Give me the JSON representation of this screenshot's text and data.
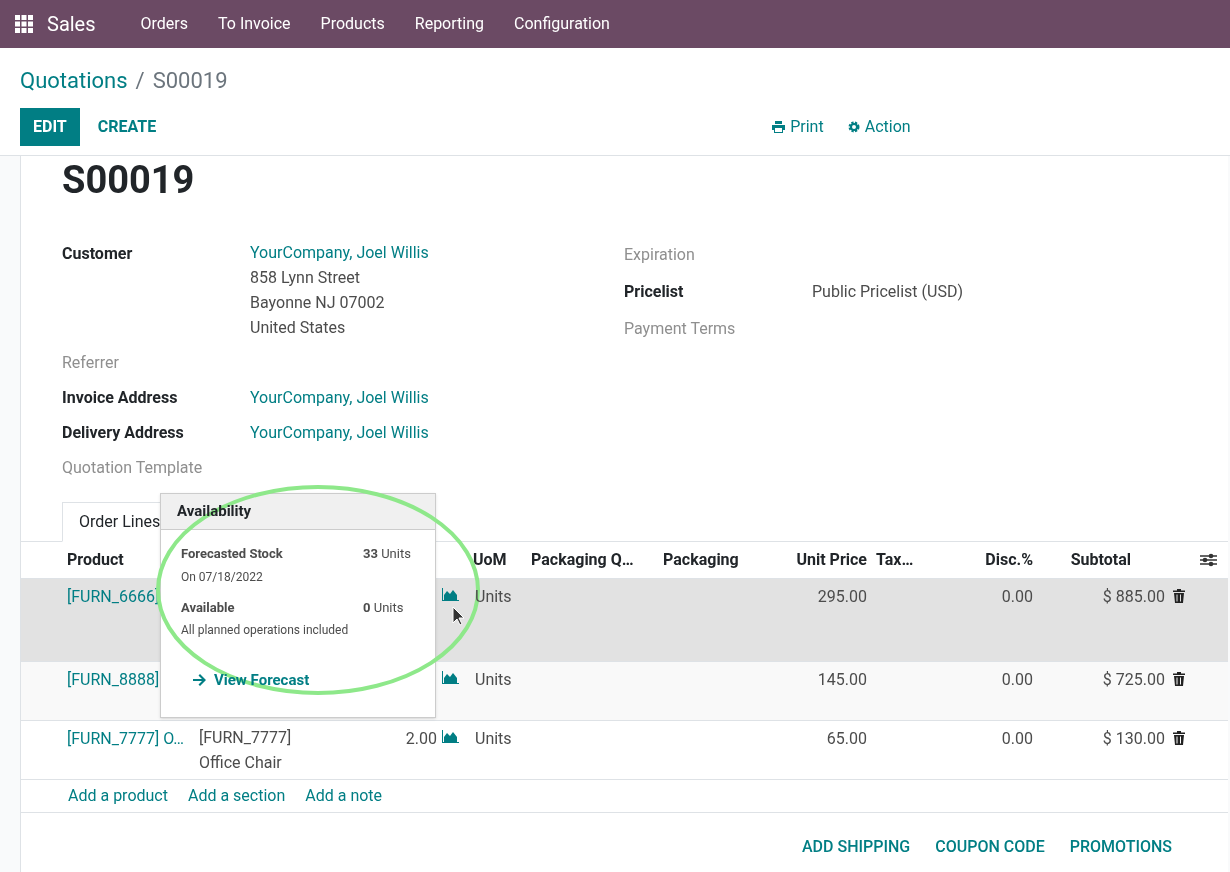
{
  "navbar": {
    "app": "Sales",
    "menu": [
      "Orders",
      "To Invoice",
      "Products",
      "Reporting",
      "Configuration"
    ]
  },
  "breadcrumb": {
    "parent": "Quotations",
    "separator": "/",
    "current": "S00019"
  },
  "actions": {
    "edit": "EDIT",
    "create": "CREATE",
    "print": "Print",
    "action": "Action"
  },
  "form": {
    "title": "S00019",
    "left_fields": [
      {
        "label": "Customer",
        "muted": false,
        "value": "YourCompany, Joel Willis",
        "address": [
          "858 Lynn Street",
          "Bayonne NJ 07002",
          "United States"
        ]
      },
      {
        "label": "Referrer",
        "muted": true
      },
      {
        "label": "Invoice Address",
        "muted": false,
        "value": "YourCompany, Joel Willis"
      },
      {
        "label": "Delivery Address",
        "muted": false,
        "value": "YourCompany, Joel Willis"
      },
      {
        "label": "Quotation Template",
        "muted": true
      }
    ],
    "right_fields": [
      {
        "label": "Expiration",
        "muted": true
      },
      {
        "label": "Pricelist",
        "muted": false,
        "value": "Public Pricelist (USD)"
      },
      {
        "label": "Payment Terms",
        "muted": true
      }
    ]
  },
  "tabs": [
    {
      "label": "Order Lines",
      "selected": true
    }
  ],
  "table": {
    "columns": [
      "Product",
      "UoM",
      "Packaging Q…",
      "Packaging",
      "Unit Price",
      "Tax…",
      "Disc.%",
      "Subtotal"
    ],
    "rows": [
      {
        "product": "[FURN_6666]",
        "uom": "Units",
        "unit_price": "295.00",
        "disc": "0.00",
        "subtotal": "$ 885.00",
        "selected": true
      },
      {
        "product": "[FURN_8888]",
        "uom": "Units",
        "unit_price": "145.00",
        "disc": "0.00",
        "subtotal": "$ 725.00",
        "selected": false
      },
      {
        "product": "[FURN_7777] O…",
        "description": [
          "[FURN_7777]",
          "Office Chair"
        ],
        "quantity": "2.00",
        "uom": "Units",
        "unit_price": "65.00",
        "disc": "0.00",
        "subtotal": "$ 130.00",
        "selected": false
      }
    ],
    "add_links": [
      "Add a product",
      "Add a section",
      "Add a note"
    ]
  },
  "popover": {
    "title": "Availability",
    "forecast_label": "Forecasted Stock",
    "forecast_value": "33",
    "forecast_unit": "Units",
    "forecast_date": "On 07/18/2022",
    "available_label": "Available",
    "available_value": "0",
    "available_unit": "Units",
    "available_note": "All planned operations included",
    "link": "View Forecast"
  },
  "footer_buttons": [
    "ADD SHIPPING",
    "COUPON CODE",
    "PROMOTIONS"
  ]
}
